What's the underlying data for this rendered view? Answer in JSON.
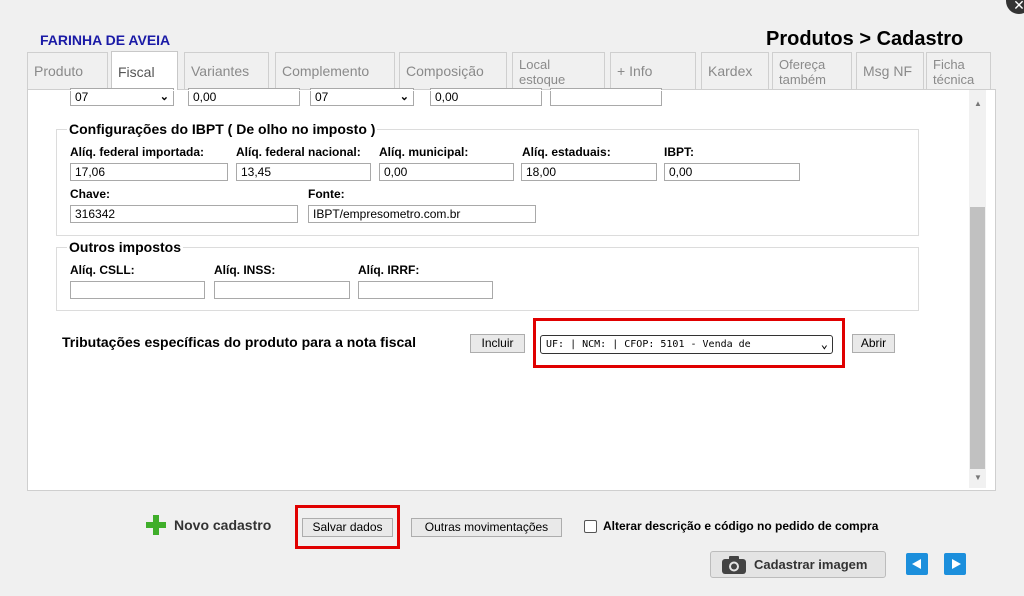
{
  "header": {
    "product_name": "FARINHA DE AVEIA",
    "title": "Produtos > Cadastro"
  },
  "tabs": [
    {
      "label": "Produto"
    },
    {
      "label": "Fiscal",
      "active": true
    },
    {
      "label": "Variantes"
    },
    {
      "label": "Complemento"
    },
    {
      "label": "Composição"
    },
    {
      "label": "Local estoque"
    },
    {
      "label": "+ Info"
    },
    {
      "label": "Kardex"
    },
    {
      "label": "Ofereça também"
    },
    {
      "label": "Msg NF"
    },
    {
      "label": "Ficha técnica"
    }
  ],
  "top_row": {
    "select1": "07",
    "value1": "0,00",
    "select2": "07",
    "value2": "0,00",
    "value3": ""
  },
  "ibpt": {
    "legend": "Configurações do IBPT ( De olho no imposto )",
    "labels": {
      "federal_importada": "Alíq. federal importada:",
      "federal_nacional": "Alíq. federal nacional:",
      "municipal": "Alíq. municipal:",
      "estaduais": "Alíq. estaduais:",
      "ibpt": "IBPT:",
      "chave": "Chave:",
      "fonte": "Fonte:"
    },
    "values": {
      "federal_importada": "17,06",
      "federal_nacional": "13,45",
      "municipal": "0,00",
      "estaduais": "18,00",
      "ibpt": "0,00",
      "chave": "316342",
      "fonte": "IBPT/empresometro.com.br"
    }
  },
  "outros": {
    "legend": "Outros impostos",
    "labels": {
      "csll": "Alíq. CSLL:",
      "inss": "Alíq. INSS:",
      "irrf": "Alíq. IRRF:"
    },
    "values": {
      "csll": "",
      "inss": "",
      "irrf": ""
    }
  },
  "tributacoes": {
    "label": "Tributações específicas do produto para a nota fiscal",
    "include_button": "Incluir",
    "selected": "UF: | NCM: | CFOP: 5101 - Venda de",
    "open_button": "Abrir"
  },
  "footer": {
    "novo_cadastro": "Novo cadastro",
    "salvar": "Salvar dados",
    "outras": "Outras movimentações",
    "checkbox_label": "Alterar descrição e código no pedido de compra",
    "cadastrar_imagem": "Cadastrar imagem"
  },
  "colors": {
    "accent_red": "#e00000",
    "nav_blue": "#1c8fdc",
    "brand_blue": "#1a1aa6",
    "plus_green": "#3fae2a"
  }
}
